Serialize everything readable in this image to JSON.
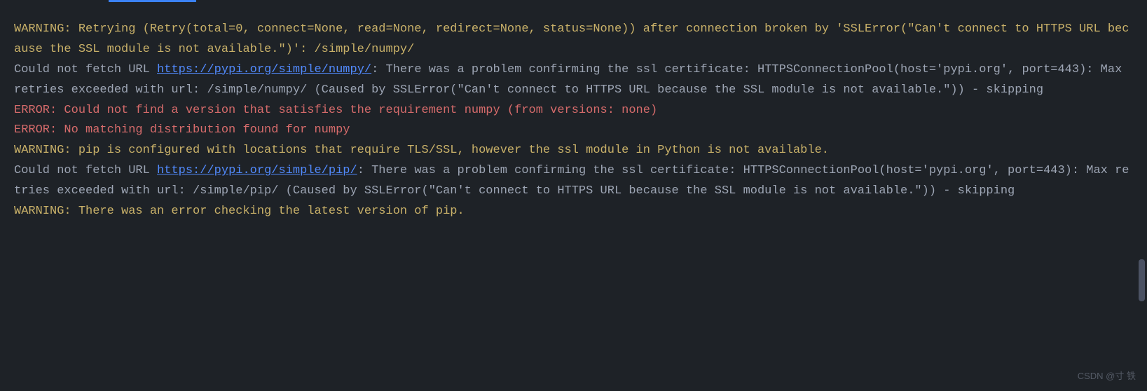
{
  "colors": {
    "background": "#1e2227",
    "warning": "#c9b169",
    "error": "#d66b6b",
    "info": "#9da5b4",
    "link": "#528bff",
    "tab_indicator": "#3b82f6"
  },
  "lines": [
    {
      "type": "warning",
      "segments": [
        {
          "kind": "text",
          "text": "WARNING: Retrying (Retry(total=0, connect=None, read=None, redirect=None, status=None)) after connection broken by 'SSLError(\"Can't connect to HTTPS URL because the SSL module is not available.\")': /simple/numpy/"
        }
      ]
    },
    {
      "type": "info",
      "segments": [
        {
          "kind": "text",
          "text": "Could not fetch URL "
        },
        {
          "kind": "link",
          "text": "https://pypi.org/simple/numpy/"
        },
        {
          "kind": "text",
          "text": ": There was a problem confirming the ssl certificate: HTTPSConnectionPool(host='pypi.org', port=443): Max retries exceeded with url: /simple/numpy/ (Caused by SSLError(\"Can't connect to HTTPS URL because the SSL module is not available.\")) - skipping"
        }
      ]
    },
    {
      "type": "error",
      "segments": [
        {
          "kind": "text",
          "text": "ERROR: Could not find a version that satisfies the requirement numpy (from versions: none)"
        }
      ]
    },
    {
      "type": "error",
      "segments": [
        {
          "kind": "text",
          "text": "ERROR: No matching distribution found for numpy"
        }
      ]
    },
    {
      "type": "warning",
      "segments": [
        {
          "kind": "text",
          "text": "WARNING: pip is configured with locations that require TLS/SSL, however the ssl module in Python is not available."
        }
      ]
    },
    {
      "type": "info",
      "segments": [
        {
          "kind": "text",
          "text": "Could not fetch URL "
        },
        {
          "kind": "link",
          "text": "https://pypi.org/simple/pip/"
        },
        {
          "kind": "text",
          "text": ": There was a problem confirming the ssl certificate: HTTPSConnectionPool(host='pypi.org', port=443): Max retries exceeded with url: /simple/pip/ (Caused by SSLError(\"Can't connect to HTTPS URL because the SSL module is not available.\")) - skipping"
        }
      ]
    },
    {
      "type": "warning",
      "segments": [
        {
          "kind": "text",
          "text": "WARNING: There was an error checking the latest version of pip."
        }
      ]
    }
  ],
  "watermark": "CSDN @寸 铁"
}
